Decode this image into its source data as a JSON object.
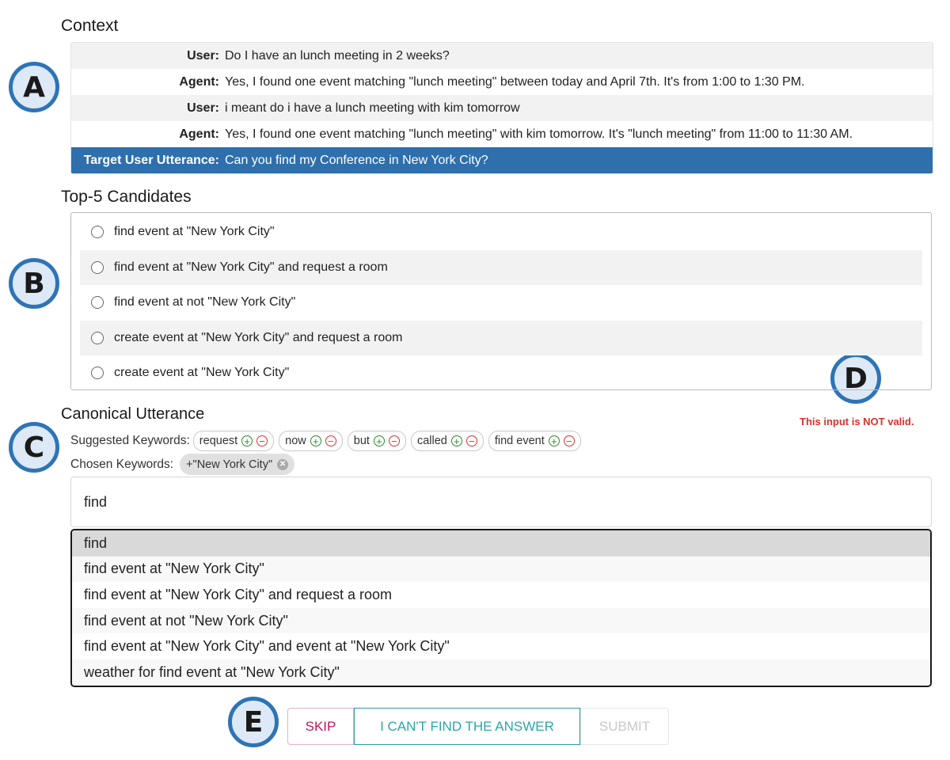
{
  "sections": {
    "context_title": "Context",
    "candidates_title": "Top-5 Candidates",
    "canonical_title": "Canonical Utterance"
  },
  "badges": [
    "A",
    "B",
    "C",
    "D",
    "E"
  ],
  "context": {
    "rows": [
      {
        "speaker": "User:",
        "text": "Do I have an lunch meeting in 2 weeks?"
      },
      {
        "speaker": "Agent:",
        "text": "Yes, I found one event matching \"lunch meeting\" between today and April 7th. It's from 1:00 to 1:30 PM."
      },
      {
        "speaker": "User:",
        "text": "i meant do i have a lunch meeting with kim tomorrow"
      },
      {
        "speaker": "Agent:",
        "text": "Yes, I found one event matching \"lunch meeting\" with kim tomorrow. It's \"lunch meeting\" from 11:00 to 11:30 AM."
      }
    ],
    "target": {
      "speaker": "Target User Utterance:",
      "text": "Can you find my Conference in New York City?"
    }
  },
  "candidates": [
    "find event at \"New York City\"",
    "find event at \"New York City\" and request a room",
    "find event at not \"New York City\"",
    "create event at \"New York City\" and request a room",
    "create event at \"New York City\""
  ],
  "validation": {
    "message": "This input is NOT valid.",
    "color": "#d9312b"
  },
  "keywords": {
    "suggested_label": "Suggested Keywords:",
    "suggested": [
      "request",
      "now",
      "but",
      "called",
      "find event"
    ],
    "chosen_label": "Chosen Keywords:",
    "chosen": [
      "+\"New York City\""
    ]
  },
  "input": {
    "value": "find"
  },
  "autocomplete": {
    "items": [
      "find",
      "find event at \"New York City\"",
      "find event at \"New York City\" and request a room",
      "find event at not \"New York City\"",
      "find event at \"New York City\" and event at \"New York City\"",
      "weather for find event at \"New York City\""
    ],
    "active_index": 0
  },
  "buttons": {
    "skip": "SKIP",
    "cant_find": "I CAN'T FIND THE ANSWER",
    "submit": "SUBMIT"
  },
  "colors": {
    "accent": "#2e6fac",
    "badge_ring": "#2e74b5",
    "plus": "#2a8a2a",
    "minus": "#e03030",
    "skip": "#c2185b",
    "cant_find": "#2aa7a7"
  }
}
